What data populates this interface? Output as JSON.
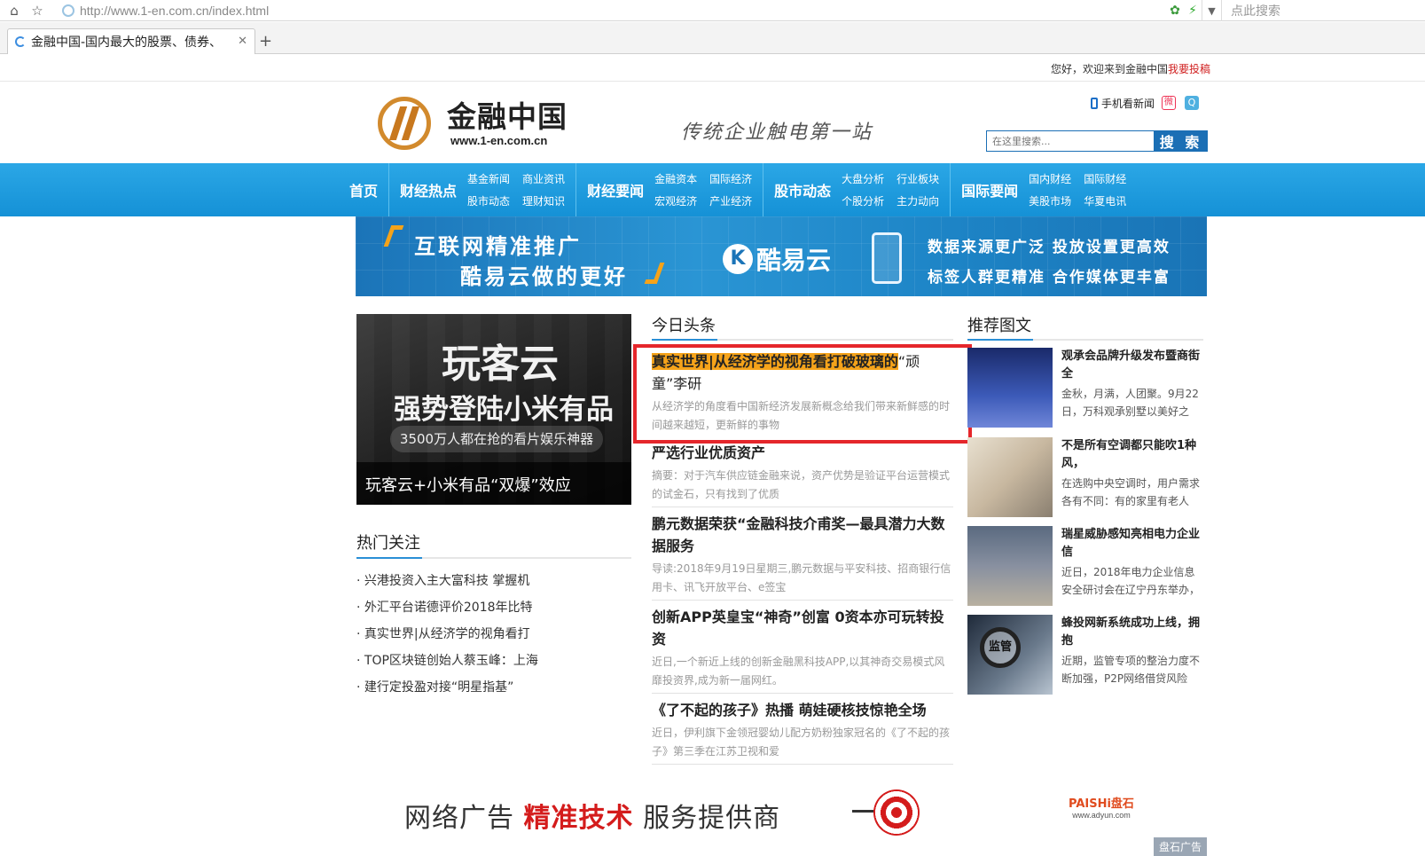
{
  "browser": {
    "url": "http://www.1-en.com.cn/index.html",
    "tab_title": "金融中国-国内最大的股票、债券、",
    "search_placeholder": "点此搜索"
  },
  "topbar": {
    "welcome": "您好，欢迎来到金融中国",
    "submit_link": "我要投稿"
  },
  "header": {
    "logo_cn": "金融中国",
    "logo_en": "www.1-en.com.cn",
    "slogan": "传统企业触电第一站",
    "mobile_news": "手机看新闻",
    "search_placeholder": "在这里搜索...",
    "search_button": "搜 索"
  },
  "nav": [
    {
      "main": "首页",
      "subs": []
    },
    {
      "main": "财经热点",
      "subs": [
        "基金新闻",
        "商业资讯",
        "股市动态",
        "理财知识"
      ]
    },
    {
      "main": "财经要闻",
      "subs": [
        "金融资本",
        "国际经济",
        "宏观经济",
        "产业经济"
      ]
    },
    {
      "main": "股市动态",
      "subs": [
        "大盘分析",
        "行业板块",
        "个股分析",
        "主力动向"
      ]
    },
    {
      "main": "国际要闻",
      "subs": [
        "国内财经",
        "国际财经",
        "美股市场",
        "华夏电讯"
      ]
    }
  ],
  "banner": {
    "line1": "互联网精准推广",
    "line2": "酷易云做的更好",
    "brand": "酷易云",
    "line3": "数据来源更广泛  投放设置更高效",
    "line4": "标签人群更精准  合作媒体更丰富"
  },
  "feature": {
    "headline1": "玩客云",
    "headline2": "强势登陆小米有品",
    "pill": "3500万人都在抢的看片娱乐神器",
    "caption": "玩客云+小米有品“双爆”效应"
  },
  "hot": {
    "title": "热门关注",
    "items": [
      "· 兴港投资入主大富科技 掌握机",
      "· 外汇平台诺德评价2018年比特",
      "· 真实世界|从经济学的视角看打",
      "· TOP区块链创始人蔡玉峰：上海",
      "· 建行定投盈对接“明星指基”"
    ]
  },
  "today": {
    "title": "今日头条",
    "headline": {
      "title_highlight": "真实世界|从经济学的视角看打破玻璃的",
      "title_rest": "“顽童”李研",
      "desc": "从经济学的角度看中国新经济发展新概念给我们带来新鲜感的时间越来越短，更新鲜的事物"
    },
    "items": [
      {
        "title": "严选行业优质资产",
        "desc": "摘要：对于汽车供应链金融来说，资产优势是验证平台运营模式的试金石，只有找到了优质"
      },
      {
        "title": "鹏元数据荣获“金融科技介甫奖—最具潜力大数据服务",
        "desc": "导读:2018年9月19日星期三,鹏元数据与平安科技、招商银行信用卡、讯飞开放平台、e签宝"
      },
      {
        "title": "创新APP英皇宝“神奇”创富 0资本亦可玩转投资",
        "desc": "近日,一个新近上线的创新金融黑科技APP,以其神奇交易模式风靡投资界,成为新一届网红。"
      },
      {
        "title": "《了不起的孩子》热播 萌娃硬核技惊艳全场",
        "desc": "近日，伊利旗下金领冠婴幼儿配方奶粉独家冠名的《了不起的孩子》第三季在江苏卫视和爱"
      }
    ]
  },
  "recommend": {
    "title": "推荐图文",
    "items": [
      {
        "title": "观承会品牌升级发布暨商街全",
        "desc": "金秋，月满，人团聚。9月22日，万科观承别墅以美好之"
      },
      {
        "title": "不是所有空调都只能吹1种风，",
        "desc": "在选购中央空调时，用户需求各有不同：有的家里有老人"
      },
      {
        "title": "瑞星威胁感知亮相电力企业信",
        "desc": "近日，2018年电力企业信息安全研讨会在辽宁丹东举办，"
      },
      {
        "title": "蜂投网新系统成功上线，拥抱",
        "desc": "近期，监管专项的整治力度不断加强，P2P网络借贷风险",
        "badge": "监管"
      }
    ]
  },
  "bottom_ad": {
    "slogan_a": "网络广告 ",
    "slogan_red": "精准技术",
    "slogan_b": " 服务提供商",
    "brand": "PAISHi盘石",
    "url": "www.adyun.com",
    "tag": "盘石广告"
  }
}
